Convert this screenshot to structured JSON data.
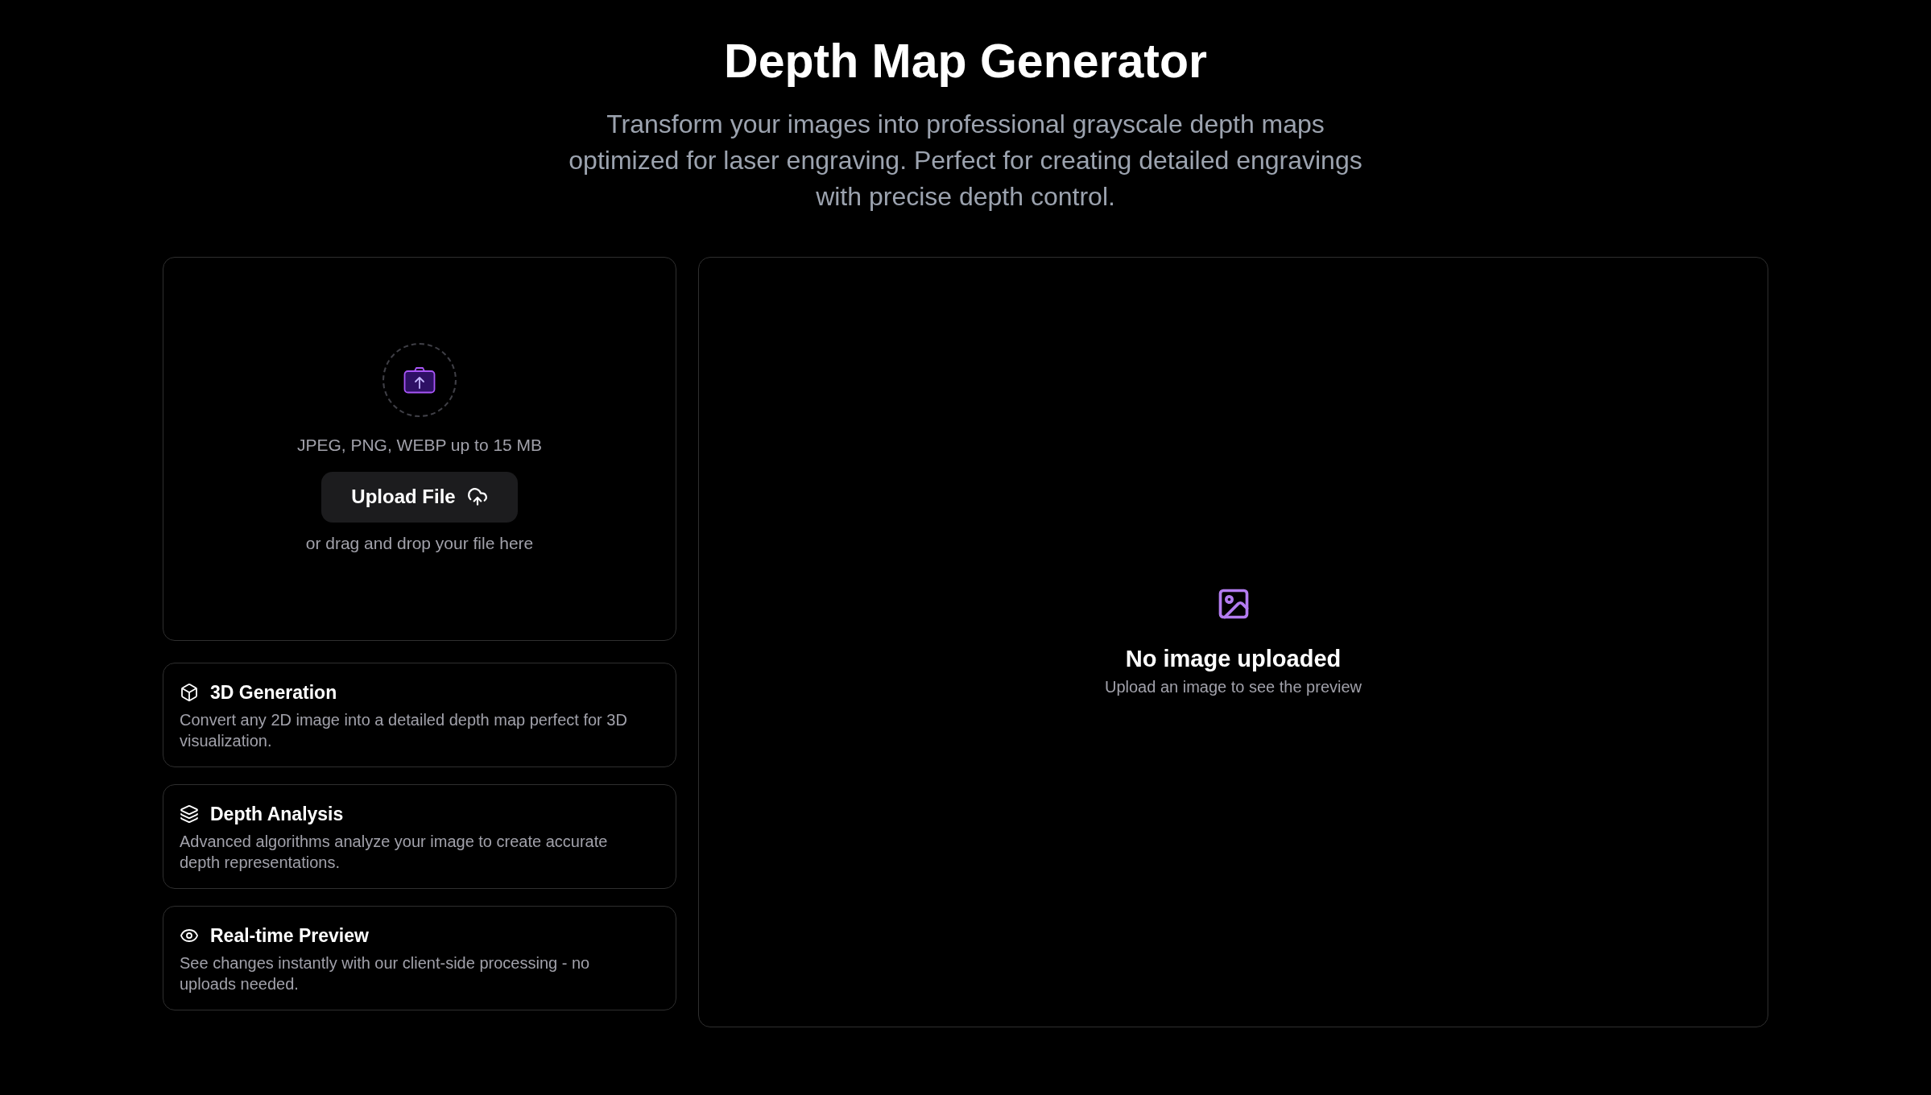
{
  "header": {
    "title": "Depth Map Generator",
    "subtitle": "Transform your images into professional grayscale depth maps optimized for laser engraving. Perfect for creating detailed engravings with precise depth control."
  },
  "upload": {
    "formats_note": "JPEG, PNG, WEBP up to 15 MB",
    "button": "Upload File",
    "drop_hint": "or drag and drop your file here"
  },
  "features": [
    {
      "title": "3D Generation",
      "description": "Convert any 2D image into a detailed depth map perfect for 3D visualization."
    },
    {
      "title": "Depth Analysis",
      "description": "Advanced algorithms analyze your image to create accurate depth representations."
    },
    {
      "title": "Real-time Preview",
      "description": "See changes instantly with our client-side processing - no uploads needed."
    }
  ],
  "preview": {
    "title": "No image uploaded",
    "hint": "Upload an image to see the preview"
  }
}
